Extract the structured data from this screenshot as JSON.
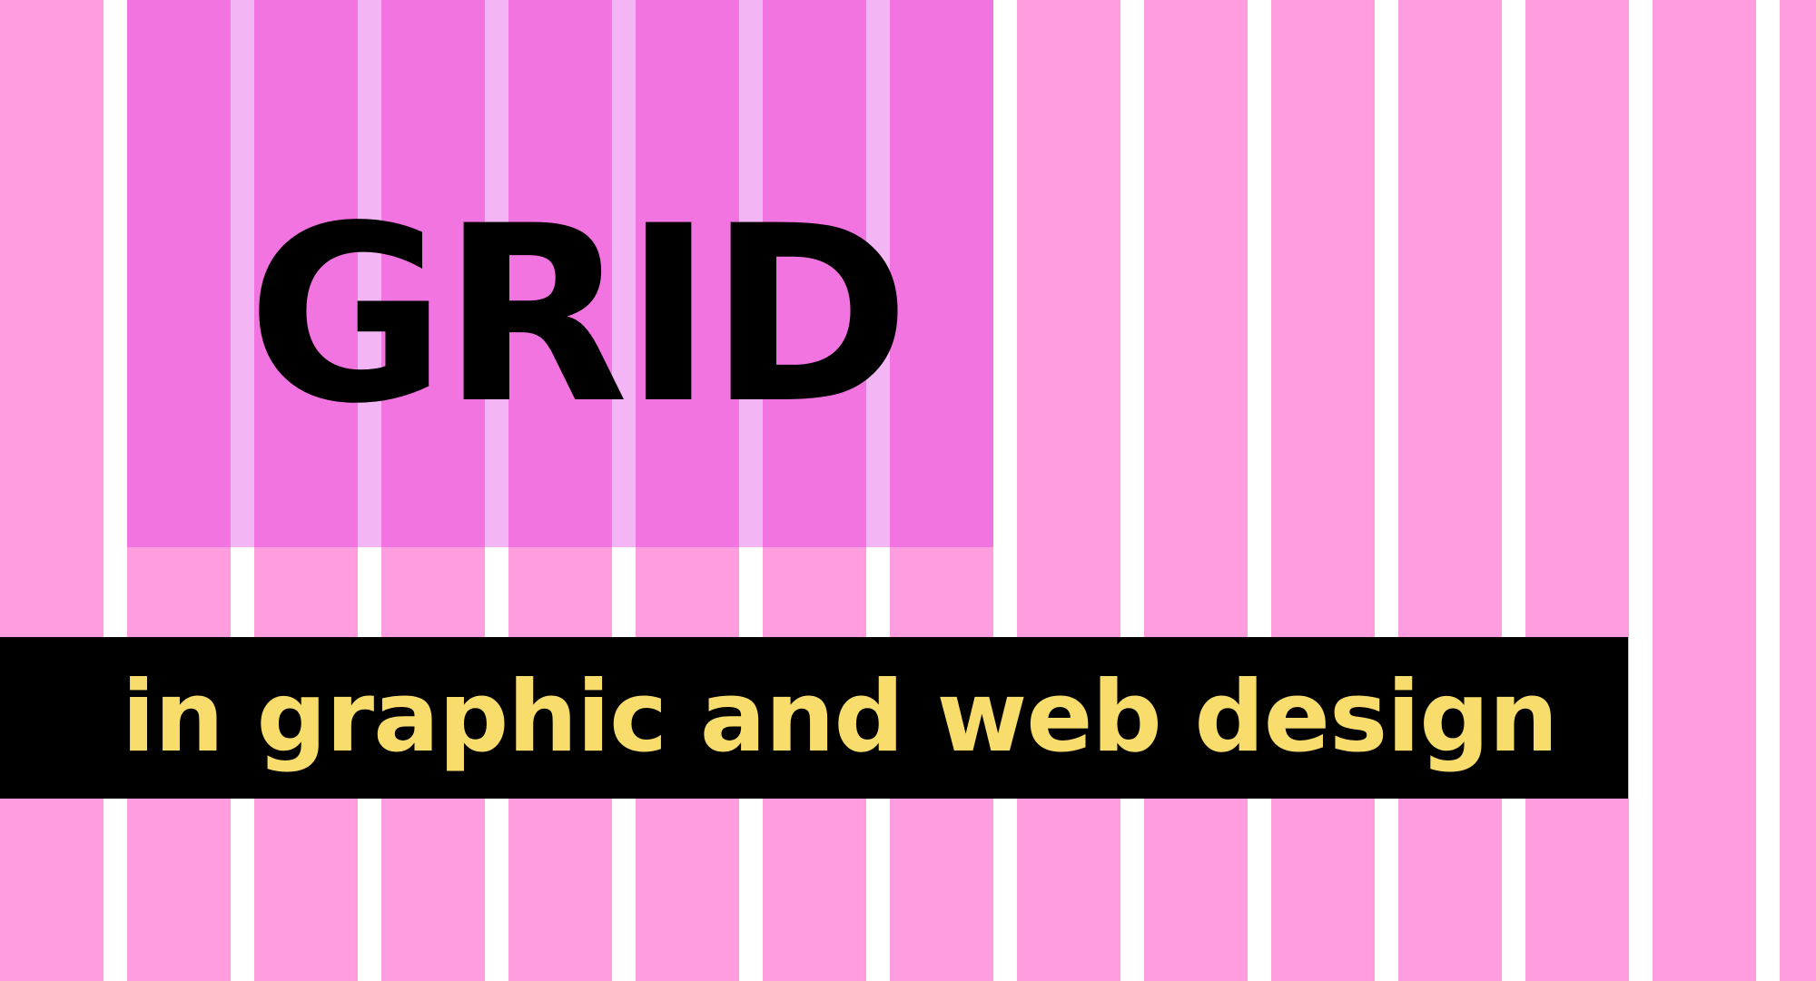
{
  "title": "GRID",
  "subtitle": "in graphic and web design",
  "colors": {
    "background": "#ffffff",
    "column": "#ff9ddf",
    "highlight": "#f274e0",
    "highlight_gutter": "#f3b5f3",
    "band": "#000000",
    "title_text": "#000000",
    "subtitle_text": "#f8dc6c"
  }
}
